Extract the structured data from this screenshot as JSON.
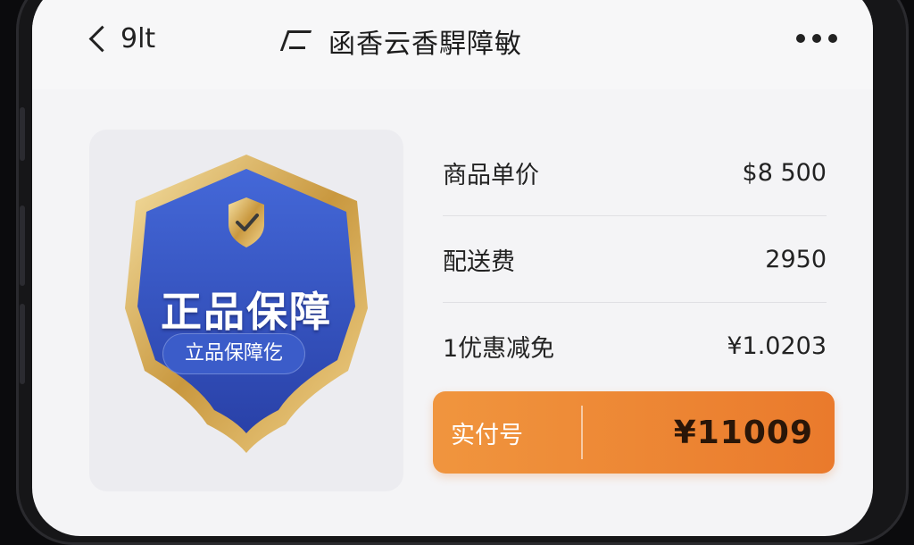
{
  "header": {
    "back_label": "9lt",
    "title": "函香云香駻障敏"
  },
  "badge": {
    "title": "正品保障",
    "subtitle": "立品保障仡"
  },
  "price_rows": [
    {
      "label": "商品单价",
      "value": "$8 500"
    },
    {
      "label": "配送费",
      "value": "2950"
    },
    {
      "label": "1优惠减免",
      "value": "¥1.0203"
    }
  ],
  "total": {
    "label": "实付号",
    "value": "¥11009"
  },
  "colors": {
    "badge_blue": "#2f4fbf",
    "gold": "#d9b15a",
    "total_orange": "#ee8534"
  }
}
